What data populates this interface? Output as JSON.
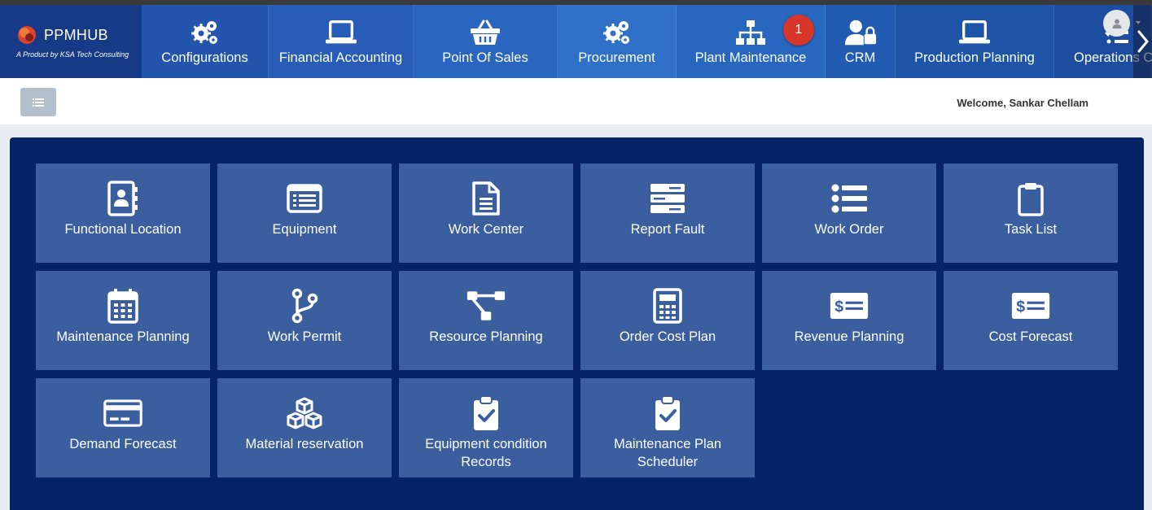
{
  "brand": {
    "name": "PPMHUB",
    "tagline": "A Product by KSA Tech Consulting"
  },
  "nav": {
    "items": [
      {
        "label": "Configurations",
        "icon": "gears-icon"
      },
      {
        "label": "Financial Accounting",
        "icon": "laptop-icon"
      },
      {
        "label": "Point Of Sales",
        "icon": "basket-icon"
      },
      {
        "label": "Procurement",
        "icon": "gears-icon"
      },
      {
        "label": "Plant Maintenance",
        "icon": "sitemap-icon",
        "badge": "1"
      },
      {
        "label": "CRM",
        "icon": "user-lock-icon"
      },
      {
        "label": "Production Planning",
        "icon": "laptop-icon"
      },
      {
        "label": "Operations C",
        "icon": "tasks-icon"
      }
    ]
  },
  "header": {
    "welcome": "Welcome, Sankar Chellam"
  },
  "tiles": [
    {
      "label": "Functional Location",
      "icon": "address-book-icon"
    },
    {
      "label": "Equipment",
      "icon": "list-alt-icon"
    },
    {
      "label": "Work Center",
      "icon": "file-icon"
    },
    {
      "label": "Report Fault",
      "icon": "server-icon"
    },
    {
      "label": "Work Order",
      "icon": "list-icon"
    },
    {
      "label": "Task List",
      "icon": "clipboard-icon"
    },
    {
      "label": "Maintenance Planning",
      "icon": "calendar-icon"
    },
    {
      "label": "Work Permit",
      "icon": "code-branch-icon"
    },
    {
      "label": "Resource Planning",
      "icon": "project-diagram-icon"
    },
    {
      "label": "Order Cost Plan",
      "icon": "calculator-icon"
    },
    {
      "label": "Revenue Planning",
      "icon": "money-check-icon"
    },
    {
      "label": "Cost Forecast",
      "icon": "money-check-icon"
    },
    {
      "label": "Demand Forecast",
      "icon": "credit-card-icon"
    },
    {
      "label": "Material reservation",
      "icon": "cubes-icon"
    },
    {
      "label": "Equipment condition Records",
      "icon": "clipboard-check-icon"
    },
    {
      "label": "Maintenance Plan Scheduler",
      "icon": "clipboard-check-icon"
    }
  ]
}
